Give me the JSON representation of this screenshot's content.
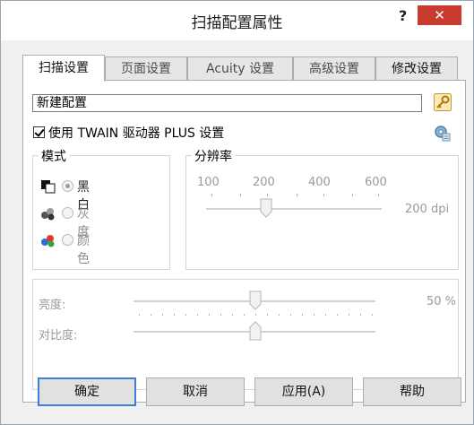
{
  "window": {
    "title": "扫描配置属性",
    "help_label": "?",
    "close_label": "✕"
  },
  "tabs": [
    {
      "label": "扫描设置",
      "active": true
    },
    {
      "label": "页面设置",
      "active": false
    },
    {
      "label": "Acuity 设置",
      "active": false
    },
    {
      "label": "高级设置",
      "active": false
    },
    {
      "label": "修改设置",
      "active": false
    }
  ],
  "config": {
    "name_value": "新建配置",
    "use_twain_label": "使用 TWAIN 驱动器 PLUS 设置",
    "use_twain_checked": true
  },
  "mode": {
    "label": "模式",
    "options": [
      {
        "label": "黑白",
        "selected": true
      },
      {
        "label": "灰度",
        "selected": false
      },
      {
        "label": "颜色",
        "selected": false
      }
    ]
  },
  "resolution": {
    "label": "分辨率",
    "ticks": [
      "100",
      "200",
      "400",
      "600"
    ],
    "value_label": "200 dpi"
  },
  "brightness": {
    "label": "亮度:",
    "value_label": "50 %"
  },
  "contrast": {
    "label": "对比度:"
  },
  "buttons": {
    "ok": "确定",
    "cancel": "取消",
    "apply": "应用(A)",
    "help": "帮助"
  },
  "colors": {
    "close_red": "#c83c2f",
    "default_button_border": "#3c7fd6",
    "disabled_text": "#9a9a9a"
  }
}
